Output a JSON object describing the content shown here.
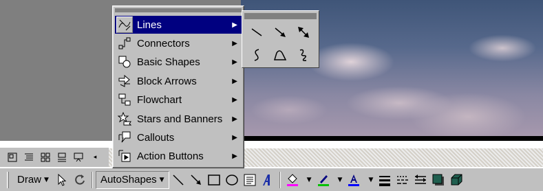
{
  "autoshapes_menu": {
    "items": [
      {
        "label": "Lines",
        "icon": "lines-icon",
        "active": true
      },
      {
        "label": "Connectors",
        "icon": "connectors-icon"
      },
      {
        "label": "Basic Shapes",
        "icon": "basic-shapes-icon"
      },
      {
        "label": "Block Arrows",
        "icon": "block-arrows-icon"
      },
      {
        "label": "Flowchart",
        "icon": "flowchart-icon"
      },
      {
        "label": "Stars and Banners",
        "icon": "stars-banners-icon"
      },
      {
        "label": "Callouts",
        "icon": "callouts-icon"
      },
      {
        "label": "Action Buttons",
        "icon": "action-buttons-icon"
      }
    ]
  },
  "lines_submenu": {
    "tools": [
      "line-icon",
      "arrow-icon",
      "double-arrow-icon",
      "curve-icon",
      "freeform-icon",
      "scribble-icon"
    ]
  },
  "view_buttons": [
    "normal-view-icon",
    "outline-view-icon",
    "slide-sorter-view-icon",
    "notes-view-icon",
    "slide-show-icon"
  ],
  "drawing_toolbar": {
    "draw_label": "Draw",
    "autoshapes_label": "AutoShapes",
    "fill_color": "#ff00ff",
    "line_color": "#00c000",
    "font_color": "#0000ff"
  }
}
